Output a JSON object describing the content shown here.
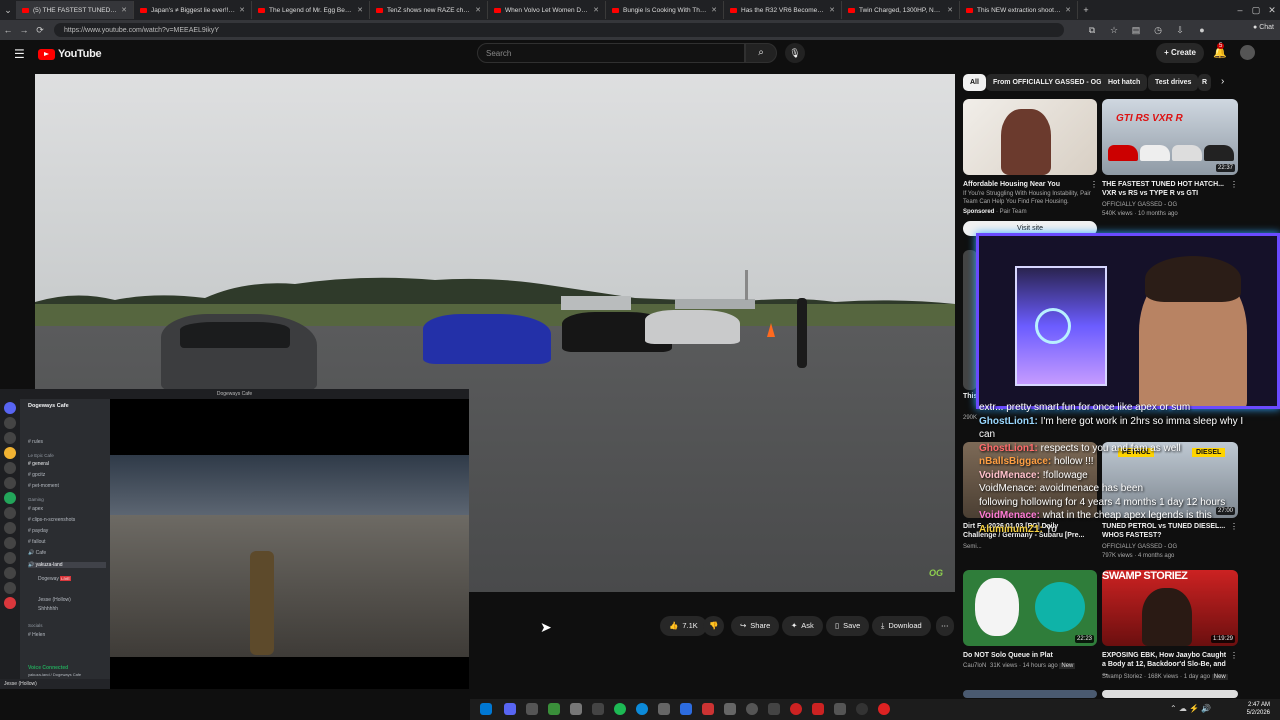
{
  "browser": {
    "tabs": [
      {
        "title": "(5) THE FASTEST TUNED HOT"
      },
      {
        "title": "Japan's ≠ Biggest lie ever!!280 Hp"
      },
      {
        "title": "The Legend of Mr. Egg Begins"
      },
      {
        "title": "TenZ shows new RAZE changes"
      },
      {
        "title": "When Volvo Let Women Design a"
      },
      {
        "title": "Bungie Is Cooking With This..."
      },
      {
        "title": "Has the R32 VR6 Become TOO Co"
      },
      {
        "title": "Twin Charged, 1300HP, No Lag"
      },
      {
        "title": "This NEW extraction shooter is W"
      }
    ],
    "url": "https://www.youtube.com/watch?v=MEEAEL9ikyY",
    "chat_label": "Chat"
  },
  "header": {
    "logo": "YouTube",
    "search_placeholder": "Search",
    "create_label": "Create",
    "notif_count": "5"
  },
  "video": {
    "watermark": "OG"
  },
  "actions": {
    "likes": "7.1K",
    "share": "Share",
    "ask": "Ask",
    "save": "Save",
    "download": "Download"
  },
  "sidebar": {
    "chips": [
      "All",
      "From OFFICIALLY GASSED - OG",
      "Hot hatch",
      "Test drives",
      "R"
    ],
    "ad": {
      "title": "Affordable Housing Near You",
      "desc": "If You're Struggling With Housing Instability, Pair Team Can Help You Find Free Housing.",
      "sponsored": "Sponsored",
      "advertiser": "· Pair Team",
      "visit": "Visit site"
    },
    "videos": [
      {
        "title": "THE FASTEST TUNED HOT HATCH... VXR vs RS vs TYPE R vs GTI",
        "channel": "OFFICIALLY GASSED - OG",
        "meta": "540K views · 10 months ago",
        "duration": "22:37",
        "thumb_text": "GTI RS VXR R"
      },
      {
        "title": "TUNED PETROL vs TUNED DIESEL... WHOS FASTEST?",
        "channel": "OFFICIALLY GASSED - OG",
        "meta": "797K views · 4 months ago",
        "duration": "27:00",
        "thumb_left": "PETROL",
        "thumb_right": "DIESEL"
      },
      {
        "title": "Dirt F... 2026 01 03 [PC] Daily Challenge / Germany - Subaru [Pre...",
        "channel": "Semi...",
        "meta": "",
        "duration": ""
      },
      {
        "title": "Do NOT Solo Queue in Plat",
        "channel": "Cau7loN",
        "meta": "31K views · 14 hours ago",
        "badge": "New",
        "duration": "22:23"
      },
      {
        "title": "EXPOSING EBK, How Jaaybo Caught a Body at 12, Backdoor'd Slo-Be, and ...",
        "channel": "Swamp Storiez",
        "meta": "168K views · 1 day ago",
        "badge": "New",
        "duration": "1:19:29",
        "thumb_text": "SWAMP STORIEZ"
      },
      {
        "title": "This...",
        "channel": "",
        "meta": "290K...",
        "duration": ""
      }
    ]
  },
  "chat": [
    {
      "name": "",
      "text": "extr... pretty smart fun for once like apex or sum"
    },
    {
      "name": "GhostLion1:",
      "text": "I'm here got work in 2hrs so imma sleep why I"
    },
    {
      "name": "",
      "text": "can"
    },
    {
      "name": "GhostLion1:",
      "text": "respects to you and fam as well"
    },
    {
      "name": "nBallsBiggace:",
      "text": "hollow !!!"
    },
    {
      "name": "VoidMenace:",
      "text": "!followage"
    },
    {
      "name": "",
      "text": "VoidMenace: avoidmenace has been"
    },
    {
      "name": "",
      "text": "following hollowing for 4 years 4 months 1 day 12 hours"
    },
    {
      "name": "VoidMenace:",
      "text": "what in the cheap apex legends is this"
    },
    {
      "name": "AluminumZ1:",
      "text": "Yo"
    }
  ],
  "discord": {
    "window_title": "Dogeways Cafe",
    "server_name": "Dogeways Cafe",
    "channels": [
      "rules",
      "general",
      "gpcitz",
      "pet-moment",
      "apex",
      "clips-n-screenshots",
      "payday",
      "fallout",
      "Cafe",
      "yakuza-land",
      "Dogeway",
      "Jesse (Hollow)",
      "Shhhhhh",
      "Helen"
    ],
    "categories": [
      "Le Epic Cafe",
      "Gaming",
      "Socials"
    ],
    "voice_status": "Voice Connected",
    "voice_channel": "yakuza-land / Dogeways Cafe",
    "user": "Jesse (Hollow)",
    "live_badge": "LIVE"
  },
  "taskbar": {
    "time": "2:47 AM",
    "date": "5/2/2026"
  },
  "colors": {
    "yt_red": "#ff0000",
    "discord_green": "#23a55a",
    "webcam_border": "#6a4bff"
  }
}
